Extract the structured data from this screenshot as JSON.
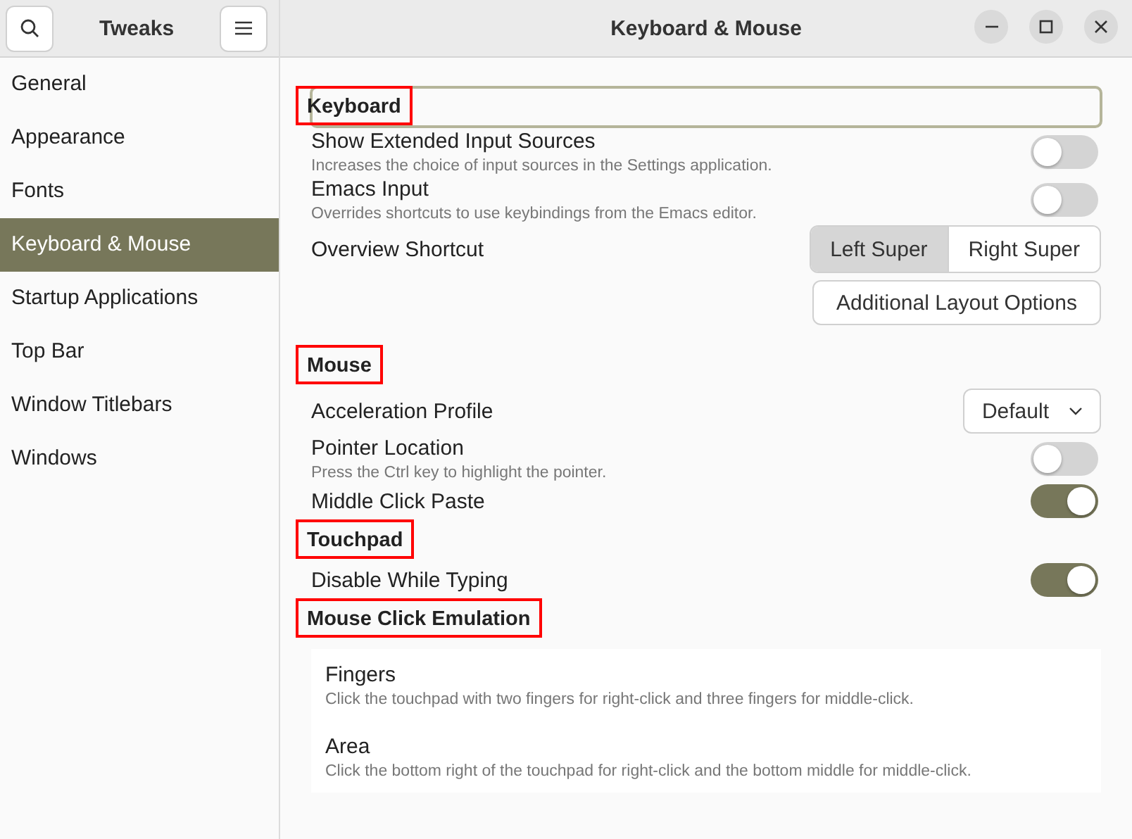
{
  "sidebar": {
    "title": "Tweaks",
    "items": [
      {
        "label": "General",
        "selected": false
      },
      {
        "label": "Appearance",
        "selected": false
      },
      {
        "label": "Fonts",
        "selected": false
      },
      {
        "label": "Keyboard & Mouse",
        "selected": true
      },
      {
        "label": "Startup Applications",
        "selected": false
      },
      {
        "label": "Top Bar",
        "selected": false
      },
      {
        "label": "Window Titlebars",
        "selected": false
      },
      {
        "label": "Windows",
        "selected": false
      }
    ]
  },
  "window": {
    "title": "Keyboard & Mouse"
  },
  "sections": [
    {
      "heading": "Keyboard",
      "highlighted": true,
      "focused": true,
      "rows": [
        {
          "kind": "switch",
          "label": "Show Extended Input Sources",
          "description": "Increases the choice of input sources in the Settings application.",
          "on": false
        },
        {
          "kind": "switch",
          "label": "Emacs Input",
          "description": "Overrides shortcuts to use keybindings from the Emacs editor.",
          "on": false
        },
        {
          "kind": "segmented",
          "label": "Overview Shortcut",
          "options": [
            {
              "label": "Left Super",
              "selected": true
            },
            {
              "label": "Right Super",
              "selected": false
            }
          ]
        },
        {
          "kind": "button",
          "label": "Additional Layout Options"
        }
      ]
    },
    {
      "heading": "Mouse",
      "highlighted": true,
      "focused": false,
      "rows": [
        {
          "kind": "dropdown",
          "label": "Acceleration Profile",
          "value": "Default"
        },
        {
          "kind": "switch",
          "label": "Pointer Location",
          "description": "Press the Ctrl key to highlight the pointer.",
          "on": false
        },
        {
          "kind": "switch",
          "label": "Middle Click Paste",
          "on": true
        }
      ]
    },
    {
      "heading": "Touchpad",
      "highlighted": true,
      "focused": false,
      "rows": [
        {
          "kind": "switch",
          "label": "Disable While Typing",
          "on": true
        }
      ]
    },
    {
      "heading": "Mouse Click Emulation",
      "highlighted": true,
      "focused": false,
      "rows": [
        {
          "kind": "options",
          "items": [
            {
              "label": "Fingers",
              "description": "Click the touchpad with two fingers for right-click and three fingers for middle-click."
            },
            {
              "label": "Area",
              "description": "Click the bottom right of the touchpad for right-click and the bottom middle for middle-click."
            }
          ]
        }
      ]
    }
  ]
}
